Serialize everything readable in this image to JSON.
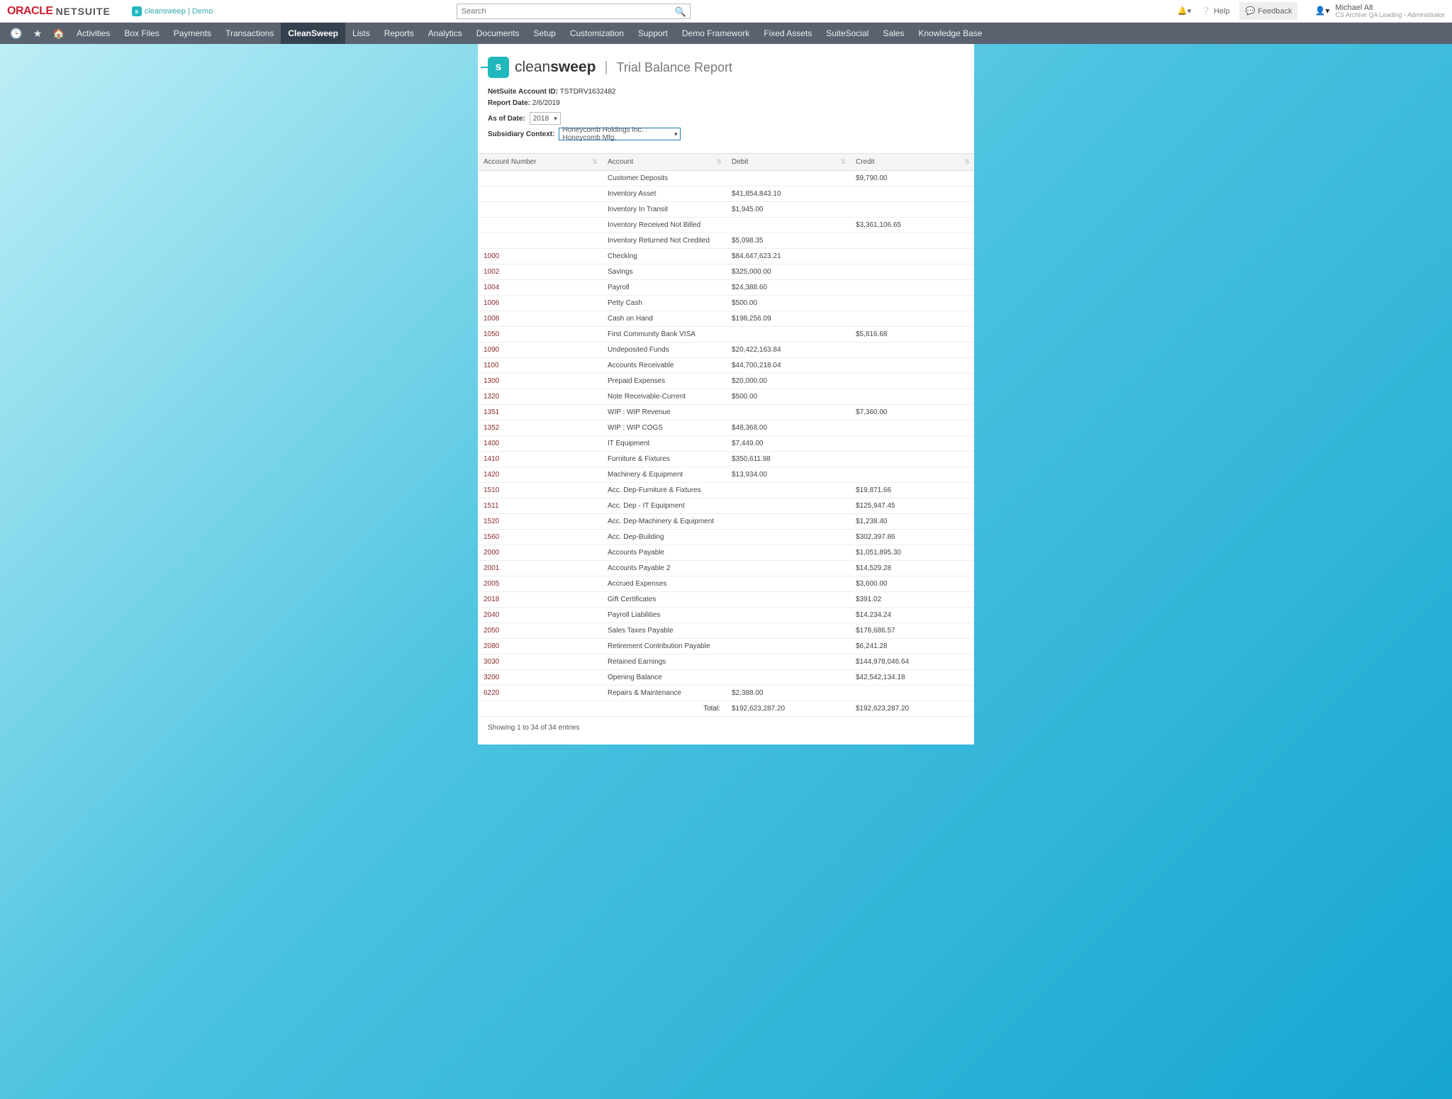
{
  "topbar": {
    "oracle": "ORACLE",
    "netsuite": "NETSUITE",
    "cs_small": "cleansweep | Demo",
    "search_placeholder": "Search",
    "help": "Help",
    "feedback": "Feedback",
    "user_name": "Michael Alt",
    "user_role": "CS Archive QA Leading - Administrator"
  },
  "nav": {
    "items": [
      "Activities",
      "Box Files",
      "Payments",
      "Transactions",
      "CleanSweep",
      "Lists",
      "Reports",
      "Analytics",
      "Documents",
      "Setup",
      "Customization",
      "Support",
      "Demo Framework",
      "Fixed Assets",
      "SuiteSocial",
      "Sales",
      "Knowledge Base"
    ],
    "active": "CleanSweep"
  },
  "header": {
    "brand_light": "clean",
    "brand_bold": "sweep",
    "title": "Trial Balance Report",
    "account_label": "NetSuite Account ID:",
    "account_id": "TSTDRV1632482",
    "report_date_label": "Report Date:",
    "report_date": "2/6/2019",
    "as_of_label": "As of Date:",
    "as_of_value": "2018",
    "sub_label": "Subsidiary Context:",
    "sub_value": "Honeycomb Holdings Inc. : Honeycomb Mfg."
  },
  "table": {
    "columns": [
      "Account Number",
      "Account",
      "Debit",
      "Credit"
    ],
    "rows": [
      {
        "num": "",
        "acct": "Customer Deposits",
        "debit": "",
        "credit": "$9,790.00"
      },
      {
        "num": "",
        "acct": "Inventory Asset",
        "debit": "$41,854,843.10",
        "credit": ""
      },
      {
        "num": "",
        "acct": "Inventory In Transit",
        "debit": "$1,945.00",
        "credit": ""
      },
      {
        "num": "",
        "acct": "Inventory Received Not Billed",
        "debit": "",
        "credit": "$3,361,106.65"
      },
      {
        "num": "",
        "acct": "Inventory Returned Not Credited",
        "debit": "$5,098.35",
        "credit": ""
      },
      {
        "num": "1000",
        "acct": "Checking",
        "debit": "$84,647,623.21",
        "credit": ""
      },
      {
        "num": "1002",
        "acct": "Savings",
        "debit": "$325,000.00",
        "credit": ""
      },
      {
        "num": "1004",
        "acct": "Payroll",
        "debit": "$24,388.60",
        "credit": ""
      },
      {
        "num": "1006",
        "acct": "Petty Cash",
        "debit": "$500.00",
        "credit": ""
      },
      {
        "num": "1008",
        "acct": "Cash on Hand",
        "debit": "$198,256.09",
        "credit": ""
      },
      {
        "num": "1050",
        "acct": "First Community Bank VISA",
        "debit": "",
        "credit": "$5,816.68"
      },
      {
        "num": "1090",
        "acct": "Undeposited Funds",
        "debit": "$20,422,163.84",
        "credit": ""
      },
      {
        "num": "1100",
        "acct": "Accounts Receivable",
        "debit": "$44,700,218.04",
        "credit": ""
      },
      {
        "num": "1300",
        "acct": "Prepaid Expenses",
        "debit": "$20,000.00",
        "credit": ""
      },
      {
        "num": "1320",
        "acct": "Note Receivable-Current",
        "debit": "$500.00",
        "credit": ""
      },
      {
        "num": "1351",
        "acct": "WIP : WIP Revenue",
        "debit": "",
        "credit": "$7,360.00"
      },
      {
        "num": "1352",
        "acct": "WIP : WIP COGS",
        "debit": "$48,368.00",
        "credit": ""
      },
      {
        "num": "1400",
        "acct": "IT Equipment",
        "debit": "$7,449.00",
        "credit": ""
      },
      {
        "num": "1410",
        "acct": "Furniture & Fixtures",
        "debit": "$350,611.98",
        "credit": ""
      },
      {
        "num": "1420",
        "acct": "Machinery & Equipment",
        "debit": "$13,934.00",
        "credit": ""
      },
      {
        "num": "1510",
        "acct": "Acc. Dep-Furniture & Fixtures",
        "debit": "",
        "credit": "$19,871.66"
      },
      {
        "num": "1511",
        "acct": "Acc. Dep - IT Equipment",
        "debit": "",
        "credit": "$125,947.45"
      },
      {
        "num": "1520",
        "acct": "Acc. Dep-Machinery & Equipment",
        "debit": "",
        "credit": "$1,238.40"
      },
      {
        "num": "1560",
        "acct": "Acc. Dep-Building",
        "debit": "",
        "credit": "$302,397.86"
      },
      {
        "num": "2000",
        "acct": "Accounts Payable",
        "debit": "",
        "credit": "$1,051,895.30"
      },
      {
        "num": "2001",
        "acct": "Accounts Payable 2",
        "debit": "",
        "credit": "$14,529.28"
      },
      {
        "num": "2005",
        "acct": "Accrued Expenses",
        "debit": "",
        "credit": "$3,600.00"
      },
      {
        "num": "2018",
        "acct": "Gift Certificates",
        "debit": "",
        "credit": "$391.02"
      },
      {
        "num": "2040",
        "acct": "Payroll Liabilities",
        "debit": "",
        "credit": "$14,234.24"
      },
      {
        "num": "2050",
        "acct": "Sales Taxes Payable",
        "debit": "",
        "credit": "$178,686.57"
      },
      {
        "num": "2080",
        "acct": "Retirement Contribution Payable",
        "debit": "",
        "credit": "$6,241.28"
      },
      {
        "num": "3030",
        "acct": "Retained Earnings",
        "debit": "",
        "credit": "$144,978,046.64"
      },
      {
        "num": "3200",
        "acct": "Opening Balance",
        "debit": "",
        "credit": "$42,542,134.18"
      },
      {
        "num": "6220",
        "acct": "Repairs & Maintenance",
        "debit": "$2,388.00",
        "credit": ""
      }
    ],
    "total_label": "Total:",
    "total_debit": "$192,623,287.20",
    "total_credit": "$192,623,287.20",
    "showing": "Showing 1 to 34 of 34 entries"
  }
}
